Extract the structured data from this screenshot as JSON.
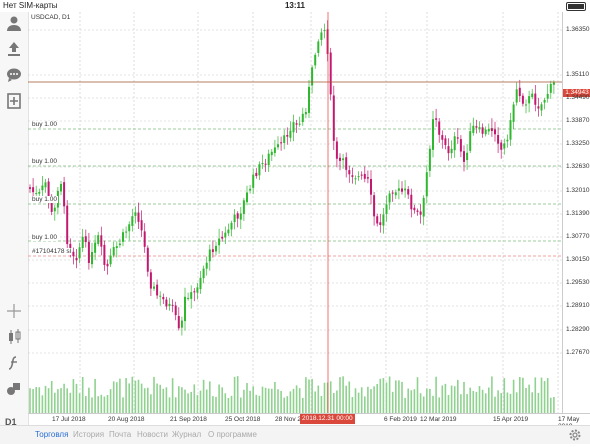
{
  "status": {
    "carrier": "Нет SIM-карты",
    "time": "13:11"
  },
  "chart": {
    "symbol": "USDCAD, D1",
    "timeframe": "D1",
    "current_price": "1.34943",
    "price_labels": [
      "1.36350",
      "1.35110",
      "1.34490",
      "1.33870",
      "1.33250",
      "1.32630",
      "1.32010",
      "1.31390",
      "1.30770",
      "1.30150",
      "1.29530",
      "1.28910",
      "1.28290",
      "1.27670"
    ],
    "date_labels": [
      "17 Jul 2018",
      "20 Aug 2018",
      "21 Sep 2018",
      "25 Oct 2018",
      "28 Nov 2018",
      "6 Feb 2019",
      "12 Mar 2019",
      "15 Apr 2019",
      "17 May 2019"
    ],
    "crosshair_date": "2018.12.31 00:00",
    "orders": [
      {
        "label": "buy 1.00"
      },
      {
        "label": "buy 1.00"
      },
      {
        "label": "buy 1.00"
      },
      {
        "label": "buy 1.00"
      },
      {
        "label": "#17104178 sl"
      }
    ],
    "colors": {
      "bull": "#2fb82f",
      "bear": "#c2186f",
      "price_line": "#a0522d",
      "crosshair": "#e53935",
      "grid": "#c8c8c8"
    }
  },
  "toolbar": {
    "icons": [
      "account-icon",
      "trade-icon",
      "chat-icon",
      "new-order-icon",
      "crosshair-icon",
      "chart-type-icon",
      "indicators-icon",
      "objects-icon"
    ]
  },
  "tabs": [
    {
      "label": "Торговля",
      "active": true
    },
    {
      "label": "История",
      "active": false
    },
    {
      "label": "Почта",
      "active": false
    },
    {
      "label": "Новости",
      "active": false
    },
    {
      "label": "Журнал",
      "active": false
    },
    {
      "label": "О программе",
      "active": false
    }
  ],
  "settings_icon": "gear-icon"
}
